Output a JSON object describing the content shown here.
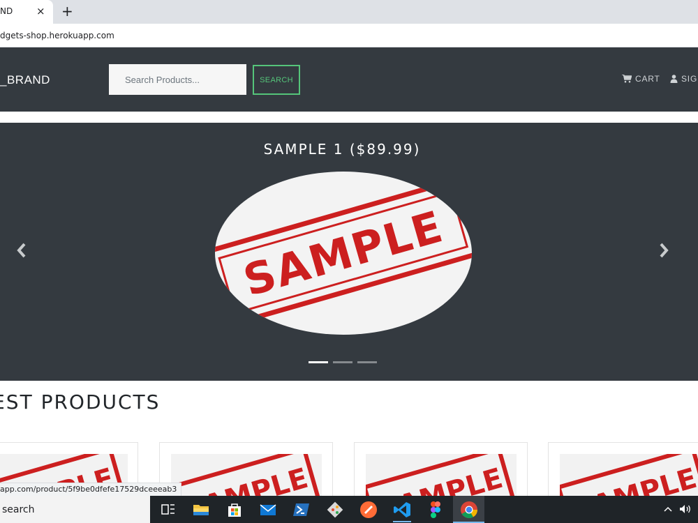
{
  "browser": {
    "tab_title": "ND",
    "tab_close": "×",
    "new_tab": "+",
    "url": "dgets-shop.herokuapp.com",
    "status_url": "app.com/product/5f9be0dfefe17529dceeeab3"
  },
  "navbar": {
    "brand": "_BRAND",
    "search_placeholder": "Search Products...",
    "search_button": "SEARCH",
    "cart_label": "CART",
    "signin_label": "SIG"
  },
  "carousel": {
    "caption": "SAMPLE 1 ($89.99)",
    "image_text": "SAMPLE",
    "indicator_count": 3,
    "active_index": 0
  },
  "section": {
    "title": "TEST PRODUCTS"
  },
  "products": [
    {
      "image_text": "SAMPLE"
    },
    {
      "image_text": "SAMPLE"
    },
    {
      "image_text": "SAMPLE"
    },
    {
      "image_text": "SAMPLE"
    }
  ],
  "taskbar": {
    "search_text": "search"
  },
  "colors": {
    "navbar_bg": "#343a40",
    "accent_green": "#55c57a",
    "sample_red": "#cc1f1f"
  }
}
